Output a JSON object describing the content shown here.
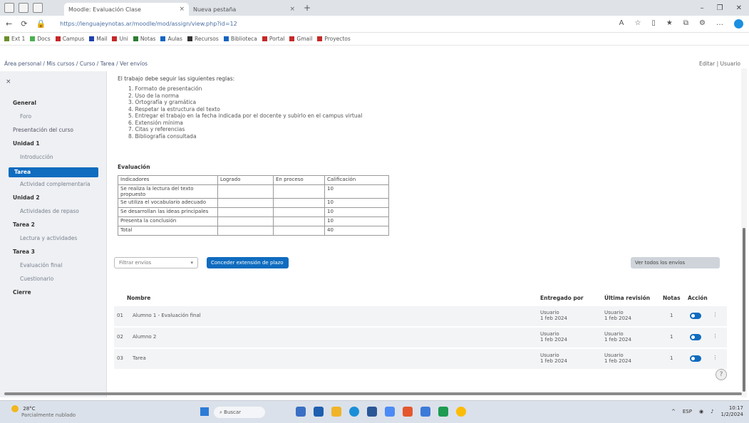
{
  "browser": {
    "tabs": [
      {
        "label": "Moodle: Evaluación Clase"
      },
      {
        "label": "Nueva pestaña"
      }
    ],
    "url": "https://lenguajeynotas.ar/moodle/mod/assign/view.php?id=12",
    "favorites": [
      "Ext 1",
      "Docs",
      "Campus",
      "Mail",
      "Uni",
      "Notas",
      "Aulas",
      "Recursos",
      "Biblioteca",
      "Portal",
      "Gmail",
      "Proyectos"
    ]
  },
  "moodle_topbar": {
    "crumb": "Área personal  /  Mis cursos  /  Curso  /  Tarea  /  Ver envíos",
    "right": "Editar  |  Usuario"
  },
  "sidebar": {
    "collapse": "×",
    "items": [
      {
        "label": "General",
        "style": "bold"
      },
      {
        "label": "Foro",
        "style": "sub"
      },
      {
        "label": "Presentación del curso",
        "style": "normal"
      },
      {
        "label": "Unidad 1",
        "style": "bold"
      },
      {
        "label": "Introducción",
        "style": "sub"
      },
      {
        "label": "Tarea",
        "style": "act"
      },
      {
        "label": "Actividad complementaria",
        "style": "sub"
      },
      {
        "label": "Unidad 2",
        "style": "bold"
      },
      {
        "label": "Actividades de repaso",
        "style": "sub"
      },
      {
        "label": "Tarea 2",
        "style": "bold"
      },
      {
        "label": "Lectura y actividades",
        "style": "sub"
      },
      {
        "label": "Tarea 3",
        "style": "bold"
      },
      {
        "label": "Evaluación final",
        "style": "sub"
      },
      {
        "label": "Cuestionario",
        "style": "sub"
      },
      {
        "label": "Cierre",
        "style": "bold"
      }
    ]
  },
  "main": {
    "intro": "El trabajo debe seguir las siguientes reglas:",
    "rules": [
      "1. Formato de presentación",
      "2. Uso de la norma",
      "3. Ortografía y gramática",
      "4. Respetar la estructura del texto",
      "5. Entregar el trabajo en la fecha indicada por el docente y subirlo en el campus virtual",
      "6. Extensión mínima",
      "7. Citas y referencias",
      "8. Bibliografía consultada"
    ],
    "rubric_title": "Evaluación",
    "rubric": {
      "headers": [
        "Indicadores",
        "Logrado",
        "En proceso",
        "Calificación"
      ],
      "rows": [
        [
          "Se realiza la lectura del texto propuesto",
          "",
          "",
          "10"
        ],
        [
          "Se utiliza el vocabulario adecuado",
          "",
          "",
          "10"
        ],
        [
          "Se desarrollan las ideas principales",
          "",
          "",
          "10"
        ],
        [
          "Presenta la conclusión",
          "",
          "",
          "10"
        ],
        [
          "Total",
          "",
          "",
          "40"
        ]
      ]
    },
    "filter_select": "Filtrar envíos",
    "grant_button": "Conceder extensión de plazo",
    "secondary_button": "Ver todos los envíos",
    "table": {
      "headers": [
        "Nombre",
        "Entregado por",
        "Última revisión",
        "Notas",
        "Acción"
      ],
      "rows": [
        {
          "idx": "01",
          "name": "Alumno 1 - Evaluación final",
          "by": "Usuario\n1 feb 2024",
          "last": "Usuario\n1 feb 2024",
          "grade": "1"
        },
        {
          "idx": "02",
          "name": "Alumno 2",
          "by": "Usuario\n1 feb 2024",
          "last": "Usuario\n1 feb 2024",
          "grade": "1"
        },
        {
          "idx": "03",
          "name": "Tarea",
          "by": "Usuario\n1 feb 2024",
          "last": "Usuario\n1 feb 2024",
          "grade": "1"
        }
      ]
    },
    "help": "?"
  },
  "taskbar": {
    "weather_temp": "28°C",
    "weather_desc": "Parcialmente nublado",
    "search": "Buscar",
    "lang": "ESP",
    "time": "10:17",
    "date": "1/2/2024"
  },
  "colors": {
    "primary": "#0f6cbf",
    "sidebar_bg": "#eef0f3"
  }
}
